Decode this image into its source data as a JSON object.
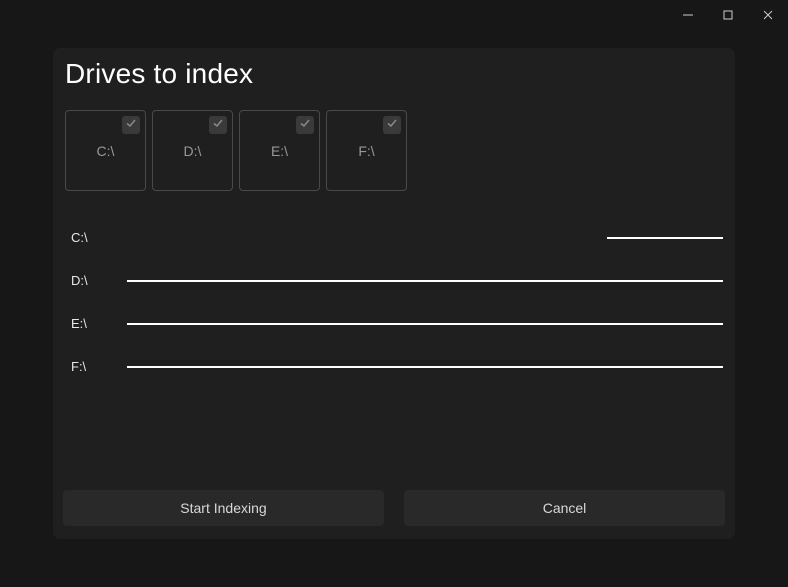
{
  "titlebar": {
    "minimize_tip": "Minimize",
    "maximize_tip": "Maximize",
    "close_tip": "Close"
  },
  "panel": {
    "title": "Drives to index"
  },
  "drives": [
    {
      "label": "C:\\",
      "checked": true
    },
    {
      "label": "D:\\",
      "checked": true
    },
    {
      "label": "E:\\",
      "checked": true
    },
    {
      "label": "F:\\",
      "checked": true
    }
  ],
  "progress": [
    {
      "label": "C:\\",
      "percent": 25,
      "short": true
    },
    {
      "label": "D:\\",
      "percent": 100,
      "short": false
    },
    {
      "label": "E:\\",
      "percent": 100,
      "short": false
    },
    {
      "label": "F:\\",
      "percent": 100,
      "short": false
    }
  ],
  "buttons": {
    "start": "Start Indexing",
    "cancel": "Cancel"
  }
}
